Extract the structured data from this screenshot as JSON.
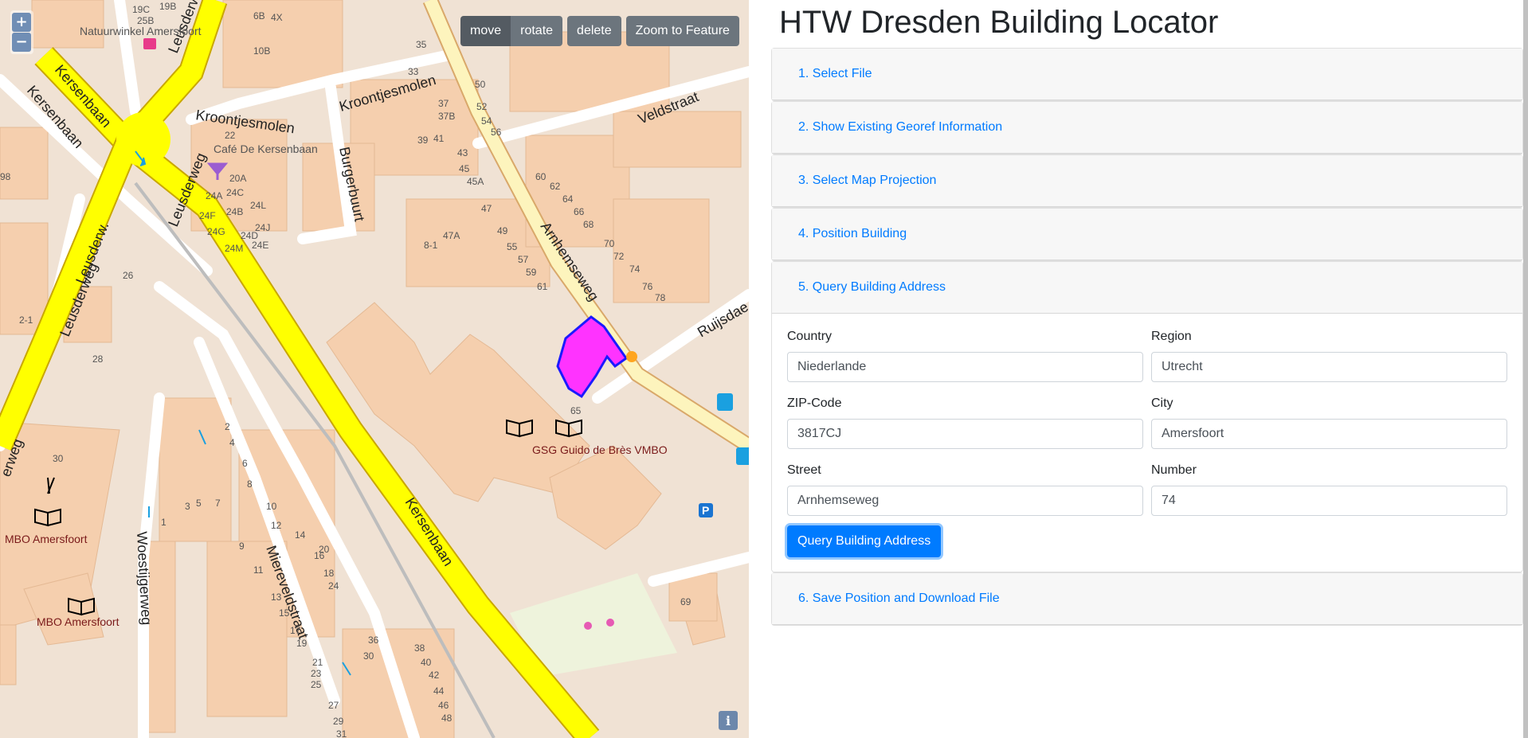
{
  "toolbar": {
    "move": "move",
    "rotate": "rotate",
    "delete": "delete",
    "zoom_to_feature": "Zoom to Feature"
  },
  "zoom": {
    "in": "+",
    "out": "−"
  },
  "attribution": {
    "info": "i"
  },
  "map": {
    "streets": {
      "kersenbaan_1": "Kersenbaan",
      "kersenbaan_2": "Kersenbaan",
      "kersenbaan_3": "Kersenbaan",
      "leusderweg_1": "Leusderweg",
      "leusderweg_2": "Leusderweg",
      "leusderweg_3": "Leusderweg",
      "leusderweg_4": "Leusderw.",
      "leusderweg_5": "erweg",
      "kroontjesmolen_1": "Kroontjesmolen",
      "kroontjesmolen_2": "Kroontjesmolen",
      "burgerbuurt": "Burgerbuurt",
      "veldstraat": "Veldstraat",
      "arnhemseweg": "Arnhemseweg",
      "ruijsdael": "Ruijsdae",
      "miereveldstraat": "Miereveldstraat",
      "woestijgerweg": "Woestijgerweg"
    },
    "pois": {
      "natuurwinkel": "Natuurwinkel Amersfoort",
      "cafe": "Café De Kersenbaan",
      "school_gsg": "GSG Guido de Brès VMBO",
      "mbo_1": "MBO Amersfoort",
      "mbo_2": "MBO Amersfoort"
    },
    "numbers": {
      "n65": "65",
      "n69": "69",
      "n26": "26",
      "n28": "28",
      "n30": "30",
      "n47": "47",
      "n47a": "47A",
      "n49": "49",
      "n55": "55",
      "n57": "57",
      "n59": "59",
      "n61": "61",
      "n60": "60",
      "n62": "62",
      "n64": "64",
      "n66": "66",
      "n68": "68",
      "n70": "70",
      "n72": "72",
      "n74": "74",
      "n76": "76",
      "n78": "78",
      "n2": "2",
      "n4": "4",
      "n6": "6",
      "n8": "8",
      "n10": "10",
      "n12": "12",
      "n14": "14",
      "n16": "16",
      "n18": "18",
      "n20": "20",
      "n24": "24",
      "n36": "36",
      "n38": "38",
      "n40": "40",
      "n42": "42",
      "n44": "44",
      "n46": "46",
      "n48": "48",
      "n50": "50",
      "n52": "52",
      "n54": "54",
      "n56": "56",
      "n35": "35",
      "n37": "37",
      "n37b": "37B",
      "n39": "39",
      "n41": "41",
      "n43": "43",
      "n45": "45",
      "n45a": "45A",
      "n1": "1",
      "n3": "3",
      "n5": "5",
      "n7": "7",
      "n9": "9",
      "n11": "11",
      "n13": "13",
      "n15": "15",
      "n17": "17",
      "n19": "19",
      "n21": "21",
      "n23": "23",
      "n25": "25",
      "n27": "27",
      "n29": "29",
      "n31": "31",
      "n33": "33",
      "n22": "22",
      "n20a": "20A",
      "n24a": "24A",
      "n24b": "24B",
      "n24c": "24C",
      "n24d": "24D",
      "n24e": "24E",
      "n24f": "24F",
      "n24g": "24G",
      "n24j": "24J",
      "n24l": "24L",
      "n24m": "24M",
      "n19b": "19B",
      "n19c": "19C",
      "n25b": "25B",
      "n6b": "6B",
      "n4x": "4X",
      "n10b": "10B",
      "n81": "8-1",
      "n21b": "2-1",
      "n36b": "36",
      "n98": "98",
      "n60b": "60"
    }
  },
  "app": {
    "title": "HTW Dresden Building Locator"
  },
  "steps": [
    {
      "label": "1. Select File"
    },
    {
      "label": "2. Show Existing Georef Information"
    },
    {
      "label": "3. Select Map Projection"
    },
    {
      "label": "4. Position Building"
    },
    {
      "label": "5. Query Building Address"
    },
    {
      "label": "6. Save Position and Download File"
    }
  ],
  "address_form": {
    "country_label": "Country",
    "country_value": "Niederlande",
    "region_label": "Region",
    "region_value": "Utrecht",
    "zip_label": "ZIP-Code",
    "zip_value": "3817CJ",
    "city_label": "City",
    "city_value": "Amersfoort",
    "street_label": "Street",
    "street_value": "Arnhemseweg",
    "number_label": "Number",
    "number_value": "74",
    "submit_label": "Query Building Address"
  },
  "colors": {
    "accent": "#007bff",
    "building_fill": "#ff33ff",
    "building_stroke": "#1a1aff",
    "major_road": "#ffff00",
    "secondary_road": "#fef7c0",
    "land": "#f1e3d6",
    "buildings": "#f5d2b3"
  }
}
